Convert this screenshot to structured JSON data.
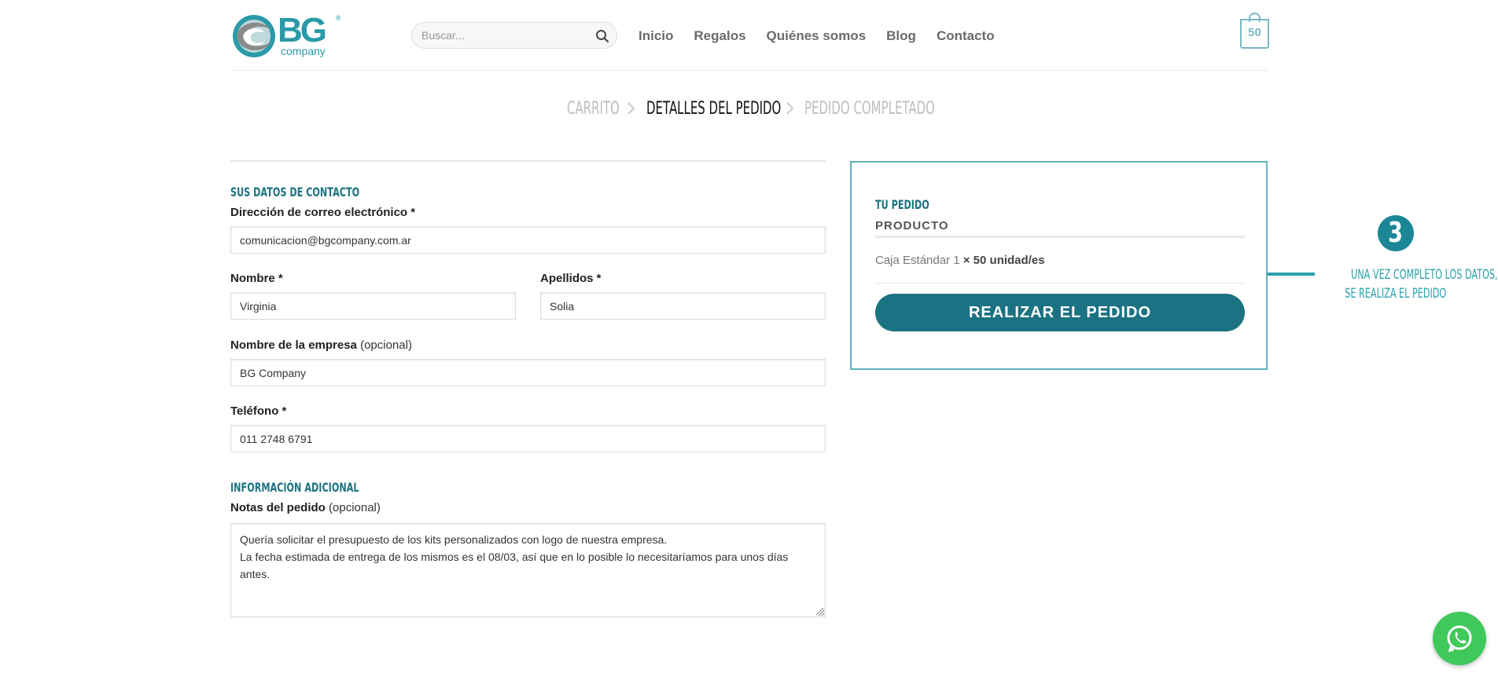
{
  "logo": {
    "text": "BG",
    "sub": "company",
    "reg": "®"
  },
  "search": {
    "placeholder": "Buscar...",
    "icon": "search-icon"
  },
  "nav": {
    "items": [
      "Inicio",
      "Regalos",
      "Quiénes somos",
      "Blog",
      "Contacto"
    ]
  },
  "cart": {
    "count": "50",
    "icon": "cart-icon"
  },
  "steps": {
    "cart": "CARRITO",
    "details": "DETALLES DEL PEDIDO",
    "completed": "PEDIDO COMPLETADO",
    "separator": ">"
  },
  "contact": {
    "title": "SUS DATOS DE CONTACTO",
    "email_label": "Dirección de correo electrónico *",
    "email_value": "comunicacion@bgcompany.com.ar",
    "first_name_label": "Nombre *",
    "first_name_value": "Virginia",
    "last_name_label": "Apellidos *",
    "last_name_value": "Solia",
    "company_label": "Nombre de la empresa",
    "company_optional": "(opcional)",
    "company_value": "BG Company",
    "phone_label": "Teléfono *",
    "phone_value": "011 2748 6791"
  },
  "additional": {
    "title": "INFORMACIÓN ADICIONAL",
    "notes_label": "Notas del pedido",
    "notes_optional": "(opcional)",
    "notes_value": "Quería solicitar el presupuesto de los kits personalizados con logo de nuestra empresa.\nLa fecha estimada de entrega de los mismos es el 08/03, así que en lo posible lo necesitaríamos para unos días antes."
  },
  "order": {
    "title": "TU PEDIDO",
    "product_header": "PRODUCTO",
    "item_name": "Caja Estándar 1",
    "item_qty": "× 50 unidad/es",
    "place_order": "REALIZAR EL PEDIDO"
  },
  "annotation": {
    "number": "3",
    "line1": "UNA VEZ COMPLETO LOS DATOS,",
    "line2": "SE REALIZA EL PEDIDO"
  },
  "whatsapp": {
    "icon": "whatsapp-icon"
  },
  "colors": {
    "brand": "#1b7282",
    "accent": "#2aa0ad",
    "whatsapp": "#3ec95a"
  }
}
